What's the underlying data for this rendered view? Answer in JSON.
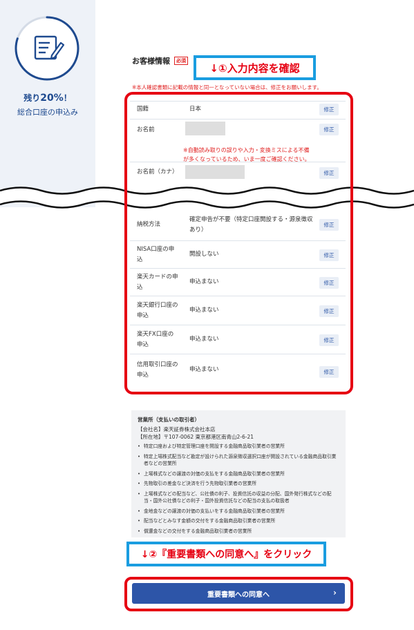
{
  "sidebar": {
    "remaining_prefix": "残り",
    "remaining_percent": "20%",
    "remaining_suffix": "！",
    "progress_fraction": 0.8,
    "flow_name": "総合口座の申込み"
  },
  "form": {
    "section_title": "お客様情報",
    "required_badge": "必須",
    "notice": "※本人確認書類に記載の情報と同一となっていない場合は、修正をお願いします。",
    "ocr_note_line1": "※自動読み取りの誤りや入力・変換ミスによる不備",
    "ocr_note_line2": "が多くなっているため、いま一度ご確認ください。",
    "edit_label": "修正",
    "rows": [
      {
        "label": "国籍",
        "value": "日本"
      },
      {
        "label": "お名前",
        "value": ""
      },
      {
        "label": "お名前（カナ）",
        "value": ""
      },
      {
        "label": "納税方法",
        "value_line1": "確定申告が不要（特定口座開設する・源泉徴収",
        "value_line2": "あり）"
      },
      {
        "label_line1": "NISA口座の申",
        "label_line2": "込",
        "value": "開設しない"
      },
      {
        "label_line1": "楽天カードの申",
        "label_line2": "込",
        "value": "申込まない"
      },
      {
        "label_line1": "楽天銀行口座の",
        "label_line2": "申込",
        "value": "申込まない"
      },
      {
        "label_line1": "楽天FX口座の",
        "label_line2": "申込",
        "value": "申込まない"
      },
      {
        "label_line1": "信用取引口座の",
        "label_line2": "申込",
        "value": "申込まない"
      }
    ]
  },
  "callouts": {
    "step1": "↓①入力内容を確認",
    "step2": "↓②『重要書類への同意へ』をクリック"
  },
  "office": {
    "heading": "営業所（支払いの取引者）",
    "company": "【会社名】楽天証券株式会社本店",
    "address": "【所在地】〒107-0062 東京都港区南青山2-6-21",
    "items": [
      "特定口座および特定管理口座を開設する金融商品取引業者の営業所",
      "特定上場株式配当など勘定が設けられた源泉徴収選択口座が開設されている金融商品取引業者などの営業所",
      "上場株式などの譲渡の対価の支払をする金融商品取引業者の営業所",
      "先物取引の差金など決済を行う先物取引業者の営業所",
      "上場株式などの配当など、公社債の利子、投資信託の収益の分配、国外発行株式などの配当・国外公社債などの利子・国外投資信託などの配当の支払の取扱者",
      "金地金などの譲渡の対価の支払いをする金融商品取引業者の営業所",
      "配当などとみなす金額の交付をする金融商品取引業者の営業所",
      "償還金などの交付をする金融商品取引業者の営業所"
    ]
  },
  "submit": {
    "label": "重要書類への同意へ",
    "chevron": "›"
  },
  "colors": {
    "accent_blue": "#2d55a8",
    "highlight_red": "#e60012",
    "callout_blue": "#1a9de0"
  }
}
